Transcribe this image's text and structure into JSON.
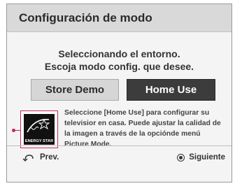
{
  "dialog": {
    "title": "Configuración de modo",
    "subtitle_line1": "Seleccionando el entorno.",
    "subtitle_line2": "Escoja modo config. que desee."
  },
  "buttons": {
    "store_demo": "Store Demo",
    "home_use": "Home Use",
    "selected": "home_use"
  },
  "energy_star": {
    "logo_text": "ENERGY STAR",
    "icon": "energy-star-icon"
  },
  "description": "Seleccione [Home Use] para configurar su televisior en casa. Puede ajustar la calidad de la imagen a través de la opciónde menú Picture Mode.",
  "footer": {
    "prev_label": "Prev.",
    "prev_icon": "back-arrow-icon",
    "next_label": "Siguiente",
    "next_icon": "ok-button-icon"
  },
  "colors": {
    "selected_button_bg": "#3c3c3c",
    "unselected_button_bg": "#d6d6d6",
    "highlight_border": "#c8245a",
    "title_bar_bg": "#d9d9d9"
  }
}
